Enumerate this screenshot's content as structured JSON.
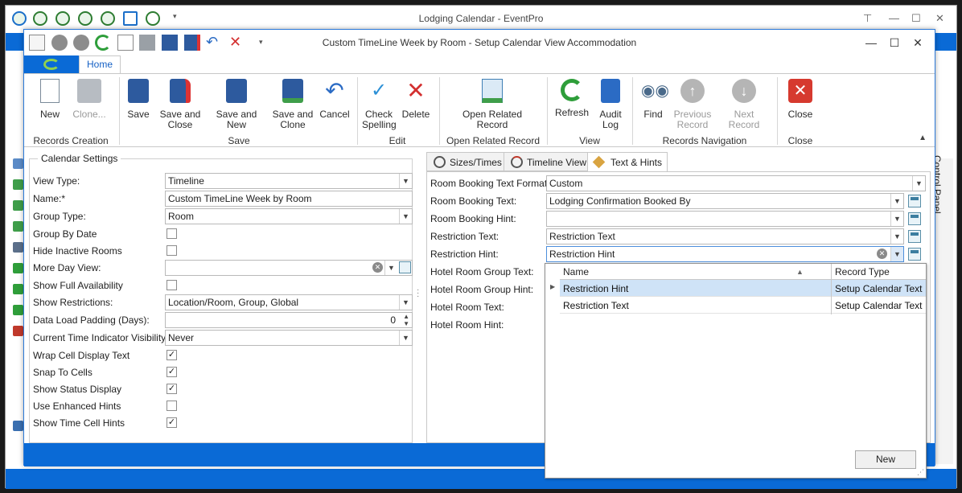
{
  "outer_window": {
    "title": "Lodging Calendar - EventPro",
    "control_panel_label": "Control Panel"
  },
  "window": {
    "title": "Custom TimeLine Week by Room - Setup Calendar View Accommodation"
  },
  "ribbon": {
    "tab_home": "Home",
    "groups": {
      "records_creation": "Records Creation",
      "save": "Save",
      "edit": "Edit",
      "open_related_record": "Open Related Record",
      "view": "View",
      "records_navigation": "Records Navigation",
      "close": "Close"
    },
    "buttons": {
      "new": "New",
      "clone": "Clone...",
      "save": "Save",
      "save_and_close": "Save and Close",
      "save_and_new": "Save and New",
      "save_and_clone": "Save and Clone",
      "cancel": "Cancel",
      "check_spelling": "Check Spelling",
      "delete": "Delete",
      "open_related_record": "Open Related Record",
      "refresh": "Refresh",
      "audit_log": "Audit Log",
      "find": "Find",
      "previous_record": "Previous Record",
      "next_record": "Next Record",
      "close": "Close"
    }
  },
  "calendar_settings": {
    "title": "Calendar Settings",
    "view_type": {
      "label": "View Type:",
      "value": "Timeline"
    },
    "name": {
      "label": "Name:*",
      "value": "Custom TimeLine Week by Room"
    },
    "group_type": {
      "label": "Group Type:",
      "value": "Room"
    },
    "group_by_date": {
      "label": "Group By Date",
      "checked": false
    },
    "hide_inactive_rooms": {
      "label": "Hide Inactive Rooms",
      "checked": false
    },
    "more_day_view": {
      "label": "More Day View:",
      "value": ""
    },
    "show_full_availability": {
      "label": "Show Full Availability",
      "checked": false
    },
    "show_restrictions": {
      "label": "Show Restrictions:",
      "value": "Location/Room, Group, Global"
    },
    "data_load_padding": {
      "label": "Data Load Padding (Days):",
      "value": "0"
    },
    "current_time_indicator": {
      "label": "Current Time Indicator Visibility:",
      "value": "Never"
    },
    "wrap_cell_display_text": {
      "label": "Wrap Cell Display Text",
      "checked": true
    },
    "snap_to_cells": {
      "label": "Snap To Cells",
      "checked": true
    },
    "show_status_display": {
      "label": "Show Status Display",
      "checked": true
    },
    "use_enhanced_hints": {
      "label": "Use Enhanced Hints",
      "checked": false
    },
    "show_time_cell_hints": {
      "label": "Show Time Cell Hints",
      "checked": true
    }
  },
  "right_tabs": {
    "sizes_times": "Sizes/Times",
    "timeline_view": "Timeline View",
    "text_hints": "Text & Hints"
  },
  "text_hints": {
    "room_booking_text_format": {
      "label": "Room Booking Text Format:",
      "value": "Custom"
    },
    "room_booking_text": {
      "label": "Room Booking Text:",
      "value": "Lodging Confirmation Booked By"
    },
    "room_booking_hint": {
      "label": "Room Booking Hint:",
      "value": ""
    },
    "restriction_text": {
      "label": "Restriction Text:",
      "value": "Restriction Text"
    },
    "restriction_hint": {
      "label": "Restriction Hint:",
      "value": "Restriction Hint"
    },
    "hotel_room_group_text": {
      "label": "Hotel Room Group Text:"
    },
    "hotel_room_group_hint": {
      "label": "Hotel Room Group Hint:"
    },
    "hotel_room_text": {
      "label": "Hotel Room Text:"
    },
    "hotel_room_hint": {
      "label": "Hotel Room Hint:"
    }
  },
  "dropdown": {
    "columns": [
      "Name",
      "Record Type"
    ],
    "rows": [
      {
        "name": "Restriction Hint",
        "record_type": "Setup Calendar Text"
      },
      {
        "name": "Restriction Text",
        "record_type": "Setup Calendar Text"
      }
    ],
    "new_button": "New"
  },
  "colors": {
    "accent": "#0a6ad6",
    "selection": "#cfe3f7"
  }
}
